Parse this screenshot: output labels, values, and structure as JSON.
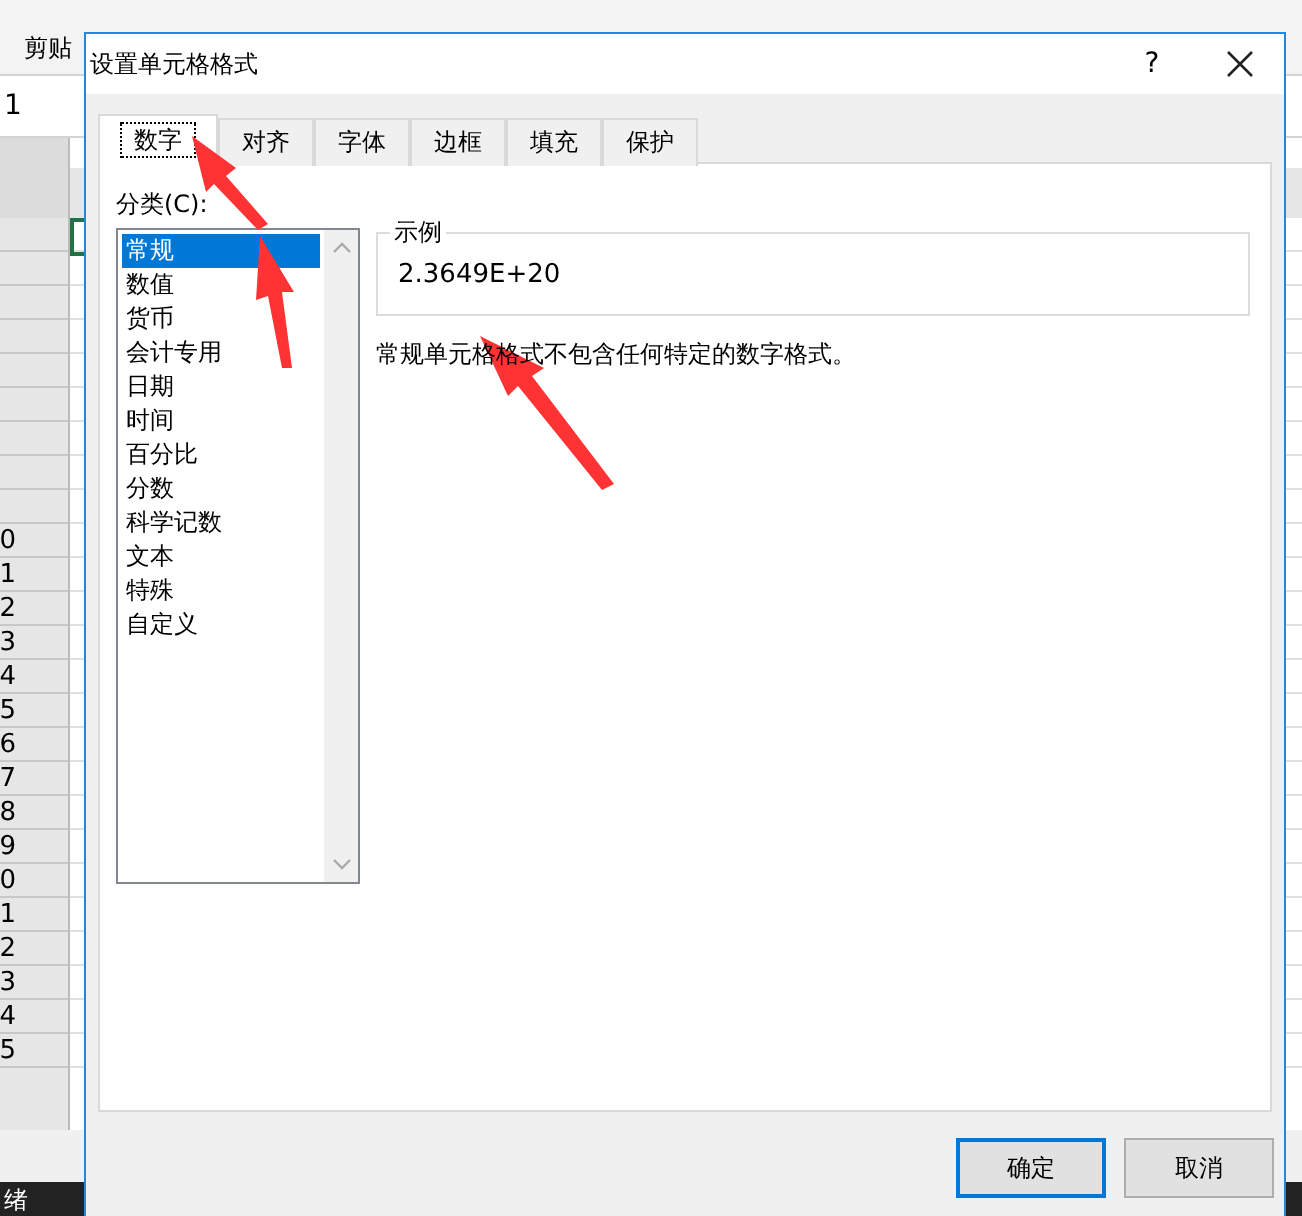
{
  "background": {
    "ribbon_group": "剪贴",
    "name_box": "1",
    "row_numbers": [
      "0",
      "1",
      "2",
      "3",
      "4",
      "5",
      "6",
      "7",
      "8",
      "9",
      "0",
      "1",
      "2",
      "3",
      "4",
      "5"
    ],
    "status": "绪"
  },
  "dialog": {
    "title": "设置单元格格式",
    "help": "?",
    "tabs": [
      {
        "label": "数字",
        "selected": true
      },
      {
        "label": "对齐",
        "selected": false
      },
      {
        "label": "字体",
        "selected": false
      },
      {
        "label": "边框",
        "selected": false
      },
      {
        "label": "填充",
        "selected": false
      },
      {
        "label": "保护",
        "selected": false
      }
    ],
    "category_label": "分类(C):",
    "categories": [
      {
        "label": "常规",
        "selected": true
      },
      {
        "label": "数值",
        "selected": false
      },
      {
        "label": "货币",
        "selected": false
      },
      {
        "label": "会计专用",
        "selected": false
      },
      {
        "label": "日期",
        "selected": false
      },
      {
        "label": "时间",
        "selected": false
      },
      {
        "label": "百分比",
        "selected": false
      },
      {
        "label": "分数",
        "selected": false
      },
      {
        "label": "科学记数",
        "selected": false
      },
      {
        "label": "文本",
        "selected": false
      },
      {
        "label": "特殊",
        "selected": false
      },
      {
        "label": "自定义",
        "selected": false
      }
    ],
    "sample": {
      "legend": "示例",
      "value": "2.3649E+20"
    },
    "description": "常规单元格格式不包含任何特定的数字格式。",
    "buttons": [
      {
        "label": "确定",
        "default": true
      },
      {
        "label": "取消",
        "default": false
      }
    ]
  }
}
